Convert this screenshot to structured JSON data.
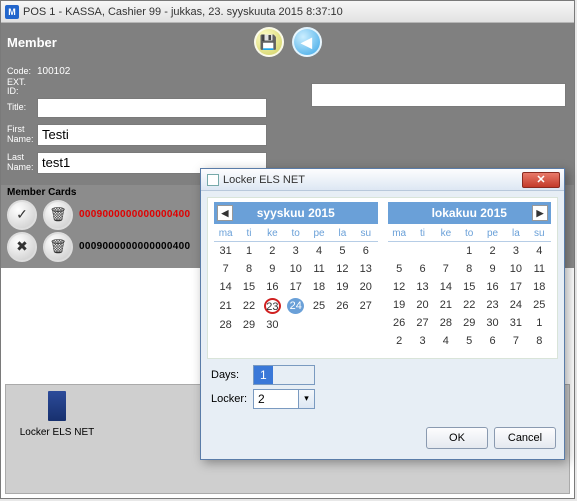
{
  "window": {
    "title": "POS 1 - KASSA, Cashier 99 - jukkas, 23. syyskuuta 2015 8:37:10"
  },
  "toolbar": {
    "title": "Member",
    "save_icon": "💾",
    "back_icon": "◀"
  },
  "form": {
    "code_label": "Code:",
    "code_value": "100102",
    "extid_label": "EXT. ID:",
    "title_label": "Title:",
    "title_value": "",
    "first_label": "First\nName:",
    "first_value": "Testi",
    "last_label": "Last\nName:",
    "last_value": "test1"
  },
  "cards": {
    "section_label": "Member Cards",
    "rows": [
      {
        "code": "0009000000000000400",
        "style": "red"
      },
      {
        "code": "0009000000000000400",
        "style": "black"
      }
    ],
    "accept_icon": "✓",
    "trash_icon": "🗑",
    "cancel_icon": "✖"
  },
  "locker_panel": {
    "label": "Locker ELS NET"
  },
  "dialog": {
    "title": "Locker ELS NET",
    "close_glyph": "✕",
    "left_month": "syyskuu 2015",
    "right_month": "lokakuu 2015",
    "dow": [
      "ma",
      "ti",
      "ke",
      "to",
      "pe",
      "la",
      "su"
    ],
    "left_grid": [
      [
        "31*",
        "1",
        "2",
        "3",
        "4",
        "5",
        "6"
      ],
      [
        "7",
        "8",
        "9",
        "10",
        "11",
        "12",
        "13"
      ],
      [
        "14",
        "15",
        "16",
        "17",
        "18",
        "19",
        "20"
      ],
      [
        "21",
        "22",
        "23!",
        "24@",
        "25",
        "26",
        "27"
      ],
      [
        "28",
        "29",
        "30",
        "",
        "",
        "",
        ""
      ]
    ],
    "right_grid": [
      [
        "",
        "",
        "",
        "1",
        "2",
        "3",
        "4"
      ],
      [
        "5",
        "6",
        "7",
        "8",
        "9",
        "10",
        "11"
      ],
      [
        "12",
        "13",
        "14",
        "15",
        "16",
        "17",
        "18"
      ],
      [
        "19",
        "20",
        "21",
        "22",
        "23",
        "24",
        "25"
      ],
      [
        "26",
        "27",
        "28",
        "29",
        "30",
        "31",
        "1*"
      ],
      [
        "2*",
        "3*",
        "4*",
        "5*",
        "6*",
        "7*",
        "8*"
      ]
    ],
    "days_label": "Days:",
    "days_value": "1",
    "locker_label": "Locker:",
    "locker_value": "2",
    "ok_label": "OK",
    "cancel_label": "Cancel"
  }
}
